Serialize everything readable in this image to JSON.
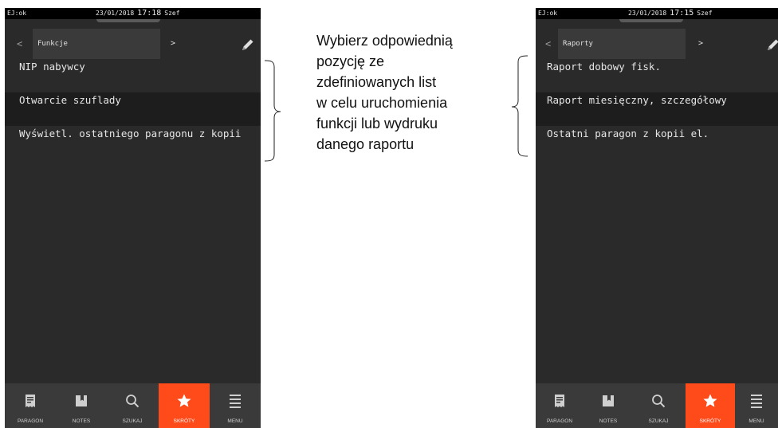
{
  "left_screen": {
    "status": {
      "ej": "EJ:ok",
      "date": "23/01/2018",
      "time": "17:18",
      "user": "Szef"
    },
    "tabbar": {
      "prev": "<",
      "title": "Funkcje",
      "next": ">",
      "edit_icon": "pencil-icon"
    },
    "items": [
      {
        "label": "NIP nabywcy"
      },
      {
        "label": "Otwarcie szuflady"
      },
      {
        "label": "Wyświetl. ostatniego paragonu z kopii"
      }
    ],
    "selected_index": 1
  },
  "right_screen": {
    "status": {
      "ej": "EJ:ok",
      "date": "23/01/2018",
      "time": "17:15",
      "user": "Szef"
    },
    "tabbar": {
      "prev": "<",
      "title": "Raporty",
      "next": ">",
      "edit_icon": "pencil-icon"
    },
    "items": [
      {
        "label": "Raport dobowy fisk."
      },
      {
        "label": "Raport miesięczny, szczegółowy"
      },
      {
        "label": "Ostatni paragon z kopii el."
      }
    ],
    "selected_index": 1
  },
  "bottom_nav": [
    {
      "label": "PARAGON",
      "icon": "receipt-icon"
    },
    {
      "label": "NOTES",
      "icon": "notes-icon"
    },
    {
      "label": "SZUKAJ",
      "icon": "search-icon"
    },
    {
      "label": "SKRÓTY",
      "icon": "star-icon",
      "active": true
    },
    {
      "label": "MENU",
      "icon": "menu-icon"
    }
  ],
  "annotation": {
    "lines": [
      "Wybierz odpowiednią",
      "pozycję ze",
      "zdefiniowanych list",
      "w celu uruchomienia",
      "funkcji lub wydruku",
      "danego raportu"
    ]
  },
  "colors": {
    "accent": "#ff4a1a",
    "screen_bg": "#2a2a2a",
    "nav_bg": "#3a3a3a",
    "selected_row": "#1d1d1d"
  }
}
